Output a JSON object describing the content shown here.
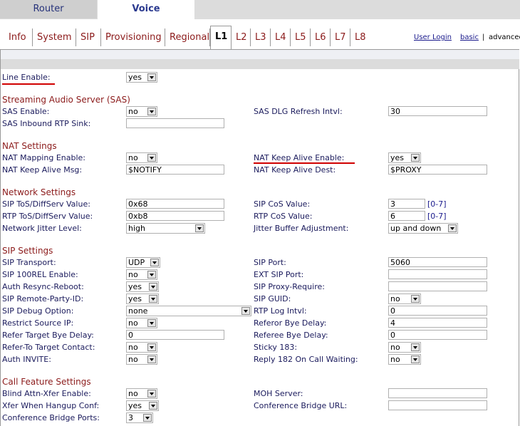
{
  "top_tabs": [
    "Router",
    "Voice"
  ],
  "sub_tabs": [
    "Info",
    "System",
    "SIP",
    "Provisioning",
    "Regional",
    "L1",
    "L2",
    "L3",
    "L4",
    "L5",
    "L6",
    "L7",
    "L8"
  ],
  "links": {
    "user_login": "User Login",
    "basic": "basic",
    "separator": "|",
    "advanced": "advanced"
  },
  "line_enable": {
    "label": "Line Enable:",
    "value": "yes"
  },
  "sections": {
    "sas": "Streaming Audio Server (SAS)",
    "nat": "NAT Settings",
    "network": "Network Settings",
    "sip": "SIP Settings",
    "call": "Call Feature Settings"
  },
  "sas": {
    "enable": {
      "label": "SAS Enable:",
      "value": "no"
    },
    "dlg": {
      "label": "SAS DLG Refresh Intvl:",
      "value": "30"
    },
    "sink": {
      "label": "SAS Inbound RTP Sink:",
      "value": ""
    }
  },
  "nat": {
    "mapping": {
      "label": "NAT Mapping Enable:",
      "value": "no"
    },
    "keepalive": {
      "label": "NAT Keep Alive Enable:",
      "value": "yes"
    },
    "msg": {
      "label": "NAT Keep Alive Msg:",
      "value": "$NOTIFY"
    },
    "dest": {
      "label": "NAT Keep Alive Dest:",
      "value": "$PROXY"
    }
  },
  "network": {
    "sip_tos": {
      "label": "SIP ToS/DiffServ Value:",
      "value": "0x68"
    },
    "sip_cos": {
      "label": "SIP CoS Value:",
      "value": "3",
      "range": "[0-7]"
    },
    "rtp_tos": {
      "label": "RTP ToS/DiffServ Value:",
      "value": "0xb8"
    },
    "rtp_cos": {
      "label": "RTP CoS Value:",
      "value": "6",
      "range": "[0-7]"
    },
    "jitter_level": {
      "label": "Network Jitter Level:",
      "value": "high"
    },
    "jitter_adj": {
      "label": "Jitter Buffer Adjustment:",
      "value": "up and down"
    }
  },
  "sip": {
    "transport": {
      "label": "SIP Transport:",
      "value": "UDP"
    },
    "port": {
      "label": "SIP Port:",
      "value": "5060"
    },
    "rel100": {
      "label": "SIP 100REL Enable:",
      "value": "no"
    },
    "ext_port": {
      "label": "EXT SIP Port:",
      "value": ""
    },
    "resync": {
      "label": "Auth Resync-Reboot:",
      "value": "yes"
    },
    "proxy_require": {
      "label": "SIP Proxy-Require:",
      "value": ""
    },
    "rpid": {
      "label": "SIP Remote-Party-ID:",
      "value": "yes"
    },
    "guid": {
      "label": "SIP GUID:",
      "value": "no"
    },
    "debug": {
      "label": "SIP Debug Option:",
      "value": "none"
    },
    "rtp_log": {
      "label": "RTP Log Intvl:",
      "value": "0"
    },
    "restrict": {
      "label": "Restrict Source IP:",
      "value": "no"
    },
    "referor": {
      "label": "Referor Bye Delay:",
      "value": "4"
    },
    "refer_target": {
      "label": "Refer Target Bye Delay:",
      "value": "0"
    },
    "referee": {
      "label": "Referee Bye Delay:",
      "value": "0"
    },
    "refer_to": {
      "label": "Refer-To Target Contact:",
      "value": "no"
    },
    "sticky": {
      "label": "Sticky 183:",
      "value": "no"
    },
    "auth_invite": {
      "label": "Auth INVITE:",
      "value": "no"
    },
    "reply182": {
      "label": "Reply 182 On Call Waiting:",
      "value": "no"
    }
  },
  "call": {
    "blind": {
      "label": "Blind Attn-Xfer Enable:",
      "value": "no"
    },
    "moh": {
      "label": "MOH Server:",
      "value": ""
    },
    "xfer_hangup": {
      "label": "Xfer When Hangup Conf:",
      "value": "yes"
    },
    "conf_url": {
      "label": "Conference Bridge URL:",
      "value": ""
    },
    "conf_ports": {
      "label": "Conference Bridge Ports:",
      "value": "3"
    }
  },
  "colors": {
    "section_heading": "#8b1a1a",
    "label": "#1a1a5c",
    "highlight_underline": "#d00000",
    "row_band": "#dcdcdc"
  }
}
